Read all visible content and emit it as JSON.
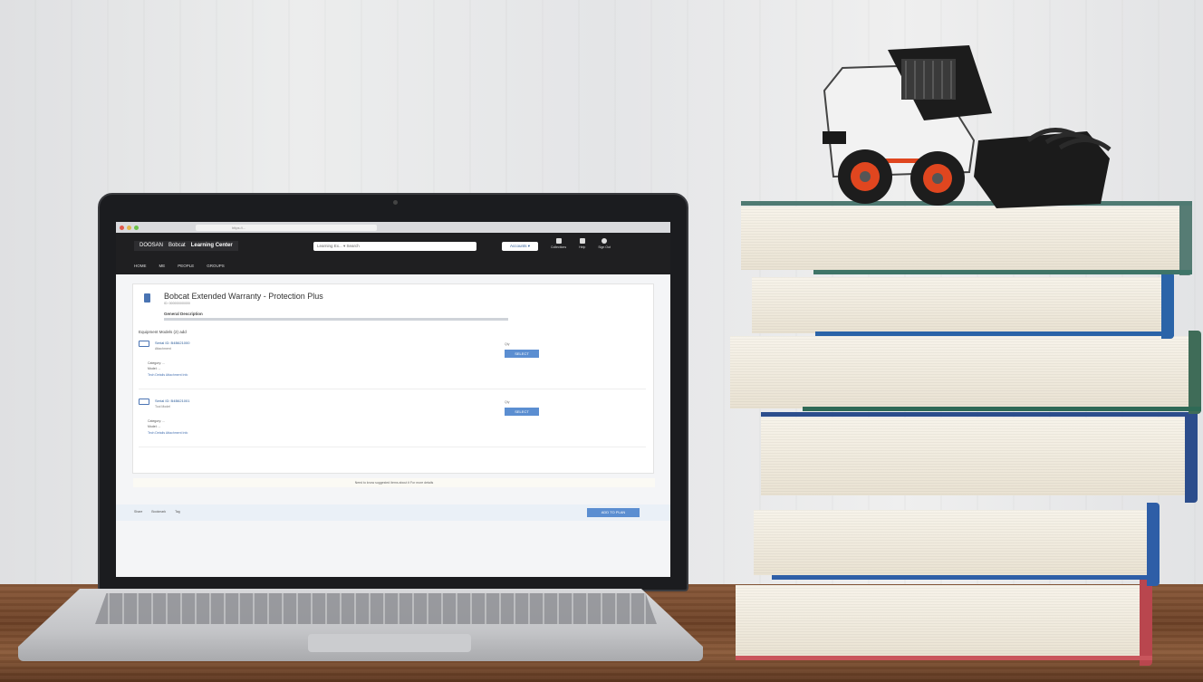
{
  "scene": {
    "description_subject": "laptop-and-books-with-toy-loader"
  },
  "browser": {
    "url": "https://..."
  },
  "app": {
    "brand_primary": "DOOSAN",
    "brand_secondary": "Bobcat",
    "title": "Learning Center",
    "search_placeholder": "Learning Ex... ▾   Search",
    "header_button": "Accounts ▾",
    "header_icons": [
      {
        "label": "Collections",
        "icon": "collections-icon"
      },
      {
        "label": "Help",
        "icon": "help-icon"
      },
      {
        "label": "Sign Out",
        "icon": "user-icon"
      }
    ],
    "nav": [
      "HOME",
      "ME",
      "PEOPLE",
      "GROUPS"
    ]
  },
  "product": {
    "title": "Bobcat Extended Warranty - Protection Plus",
    "subtitle": "ID: 000000000000",
    "description_label": "General Description"
  },
  "equipment": {
    "heading": "Equipment Models (2) add",
    "items": [
      {
        "serial": "Serial ID: B4B621000",
        "type": "Attachment",
        "meta": "Category: ...\nModel: ...",
        "links": "Tech Details   Attachment Info",
        "qty_label": "Qty",
        "select": "SELECT"
      },
      {
        "serial": "Serial ID: B4B621001",
        "type": "Tool Model",
        "meta": "Category: ...\nModel: ...",
        "links": "Tech Details   Attachment Info",
        "qty_label": "Qty",
        "select": "SELECT"
      }
    ]
  },
  "note": "Need to know suggested items about it   For more details",
  "footer": {
    "links": [
      "Share",
      "Bookmark",
      "Tag"
    ],
    "cta": "ADD TO PLAN"
  },
  "colors": {
    "accent": "#5b8ed1",
    "header_bg": "#1f1f21",
    "loader_orange": "#e0461f"
  }
}
